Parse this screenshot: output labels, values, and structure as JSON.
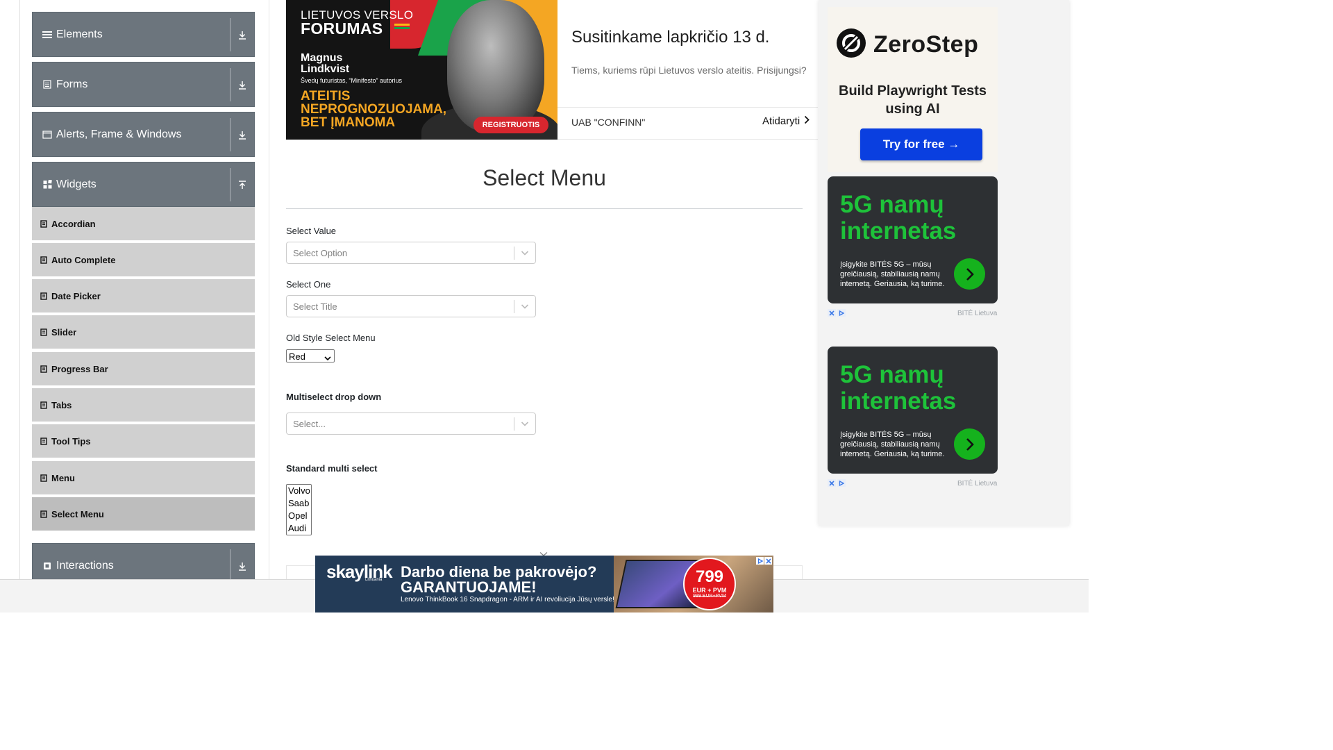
{
  "sidebar": {
    "groups": {
      "elements": "Elements",
      "forms": "Forms",
      "alerts": "Alerts, Frame & Windows",
      "widgets": "Widgets",
      "interactions": "Interactions"
    },
    "items": [
      "Accordian",
      "Auto Complete",
      "Date Picker",
      "Slider",
      "Progress Bar",
      "Tabs",
      "Tool Tips",
      "Menu",
      "Select Menu"
    ],
    "active_item": "Select Menu"
  },
  "top_ad": {
    "image": {
      "event_line1": "LIETUVOS VERSLO",
      "event_line2": "FORUMAS",
      "speaker": "Magnus Lindkvist",
      "speaker_role": "Švedų futuristas, “Minifesto” autorius",
      "slogan": "ATEITIS NEPROGNOZUOJAMA, BET ĮMANOMA",
      "register": "REGISTRUOTIS"
    },
    "headline": "Susitinkame lapkričio 13 d.",
    "subtext": "Tiems, kuriems rūpi Lietuvos verslo ateitis. Prisijungsi?",
    "advertiser": "UAB \"CONFINN\"",
    "open_label": "Atidaryti"
  },
  "main": {
    "title": "Select Menu",
    "select_value": {
      "label": "Select Value",
      "placeholder": "Select Option"
    },
    "select_one": {
      "label": "Select One",
      "placeholder": "Select Title"
    },
    "old_style": {
      "label": "Old Style Select Menu",
      "value": "Red"
    },
    "multiselect": {
      "label": "Multiselect drop down",
      "placeholder": "Select..."
    },
    "standard_multi": {
      "label": "Standard multi select",
      "options": [
        "Volvo",
        "Saab",
        "Opel",
        "Audi"
      ]
    }
  },
  "right_ad": {
    "zerostep": {
      "brand": "ZeroStep",
      "tagline": "Build Playwright Tests using AI",
      "cta": "Try for free →"
    },
    "bite_ads": [
      {
        "headline": "5G namų internetas",
        "body": "Įsigykite BITĖS 5G – mūsų greičiausią, stabiliausią namų internetą. Geriausia, ką turime.",
        "brand": "BITĖ Lietuva"
      },
      {
        "headline": "5G namų internetas",
        "body": "Įsigykite BITĖS 5G – mūsų greičiausią, stabiliausią namų internetą. Geriausia, ką turime.",
        "brand": "BITĖ Lietuva"
      }
    ]
  },
  "bottom_ad": {
    "logo": "skaylink",
    "logo_sub": "Lithuania",
    "headline1": "Darbo diena be pakrovėjo?",
    "headline2": "GARANTUOJAME!",
    "subline": "Lenovo ThinkBook 16 Snapdragon - ARM ir AI revoliucija Jūsų versle!",
    "price": "799",
    "price_unit": "EUR + PVM",
    "old_price": "999 EUR+PVM"
  },
  "colors": {
    "sidebar_group": "#6c757d",
    "sidebar_item": "#d0d0d0",
    "sidebar_item_active": "#bdbdbd",
    "zerostep_button": "#0a3fe0",
    "bite_green": "#1ec23a"
  }
}
